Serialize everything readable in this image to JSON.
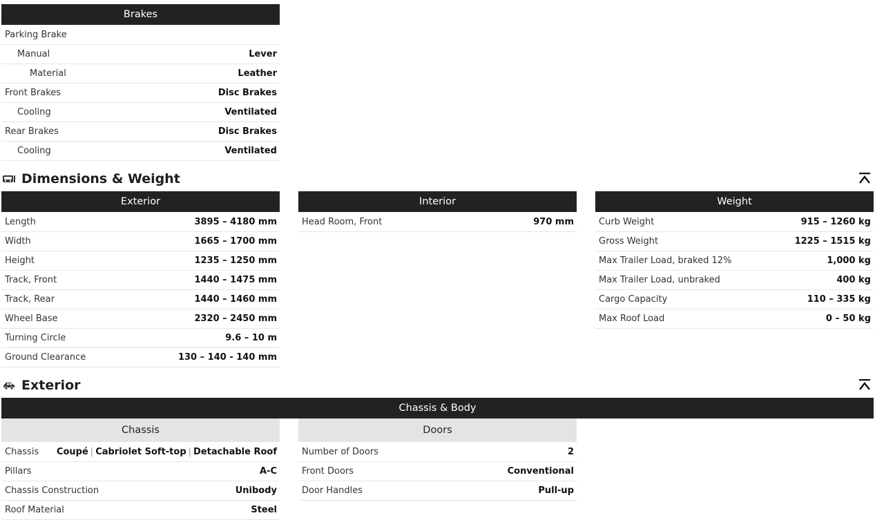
{
  "brakes": {
    "title": "Brakes",
    "rows": [
      {
        "label": "Parking Brake",
        "value": ""
      },
      {
        "label": "Manual",
        "value": "Lever"
      },
      {
        "label": "Material",
        "value": "Leather"
      },
      {
        "label": "Front Brakes",
        "value": "Disc Brakes"
      },
      {
        "label": "Cooling",
        "value": "Ventilated"
      },
      {
        "label": "Rear Brakes",
        "value": "Disc Brakes"
      },
      {
        "label": "Cooling",
        "value": "Ventilated"
      }
    ]
  },
  "dimensions": {
    "section_title": "Dimensions & Weight",
    "section_icon": "car-front-icon",
    "collapse_icon": "chevron-up-bar-icon",
    "exterior": {
      "title": "Exterior",
      "rows": [
        {
          "label": "Length",
          "value": "3895 – 4180 mm"
        },
        {
          "label": "Width",
          "value": "1665 – 1700 mm"
        },
        {
          "label": "Height",
          "value": "1235 – 1250 mm"
        },
        {
          "label": "Track, Front",
          "value": "1440 – 1475 mm"
        },
        {
          "label": "Track, Rear",
          "value": "1440 – 1460 mm"
        },
        {
          "label": "Wheel Base",
          "value": "2320 – 2450 mm"
        },
        {
          "label": "Turning Circle",
          "value": "9.6 – 10 m"
        },
        {
          "label": "Ground Clearance",
          "value": "130 – 140 - 140 mm"
        }
      ]
    },
    "interior": {
      "title": "Interior",
      "rows": [
        {
          "label": "Head Room, Front",
          "value": "970 mm"
        }
      ]
    },
    "weight": {
      "title": "Weight",
      "rows": [
        {
          "label": "Curb Weight",
          "value": "915 – 1260 kg"
        },
        {
          "label": "Gross Weight",
          "value": "1225 – 1515 kg"
        },
        {
          "label": "Max Trailer Load, braked 12%",
          "value": "1,000 kg"
        },
        {
          "label": "Max Trailer Load, unbraked",
          "value": "400 kg"
        },
        {
          "label": "Cargo Capacity",
          "value": "110 – 335 kg"
        },
        {
          "label": "Max Roof Load",
          "value": "0 – 50 kg"
        }
      ]
    }
  },
  "exterior_section": {
    "section_title": "Exterior",
    "section_icon": "car-side-icon",
    "collapse_icon": "chevron-up-bar-icon",
    "chassis_body_title": "Chassis & Body",
    "chassis": {
      "title": "Chassis",
      "rows": [
        {
          "label": "Chassis",
          "values": [
            "Coupé",
            "Cabriolet Soft-top",
            "Detachable Roof"
          ],
          "separator": "|"
        },
        {
          "label": "Pillars",
          "value": "A-C"
        },
        {
          "label": "Chassis Construction",
          "value": "Unibody"
        },
        {
          "label": "Roof Material",
          "value": "Steel"
        }
      ]
    },
    "doors": {
      "title": "Doors",
      "rows": [
        {
          "label": "Number of Doors",
          "value": "2"
        },
        {
          "label": "Front Doors",
          "value": "Conventional"
        },
        {
          "label": "Door Handles",
          "value": "Pull-up"
        }
      ]
    }
  }
}
